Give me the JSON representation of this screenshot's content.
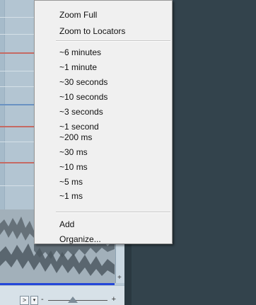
{
  "context_menu": {
    "group_zoom": [
      "Zoom Full",
      "Zoom to Locators"
    ],
    "group_durations": [
      "~6 minutes",
      "~1 minute",
      "~30 seconds",
      "~10 seconds",
      "~3 seconds",
      "~1 second",
      "~200 ms",
      "~30 ms",
      "~10 ms",
      "~5 ms",
      "~1 ms"
    ],
    "group_presets": [
      "Add",
      "Organize..."
    ]
  },
  "zoom_controls": {
    "scroll_right_glyph": ">",
    "dropdown_glyph": "▾",
    "minus_glyph": "-",
    "plus_glyph": "+",
    "side_plus_glyph": "+"
  },
  "colors": {
    "menu_background": "#f0f0f0",
    "dark_panel": "#33434c",
    "track_red_line": "#c56a63",
    "track_blue_line": "#6a92c2",
    "cursor_blue": "#2446d9"
  }
}
